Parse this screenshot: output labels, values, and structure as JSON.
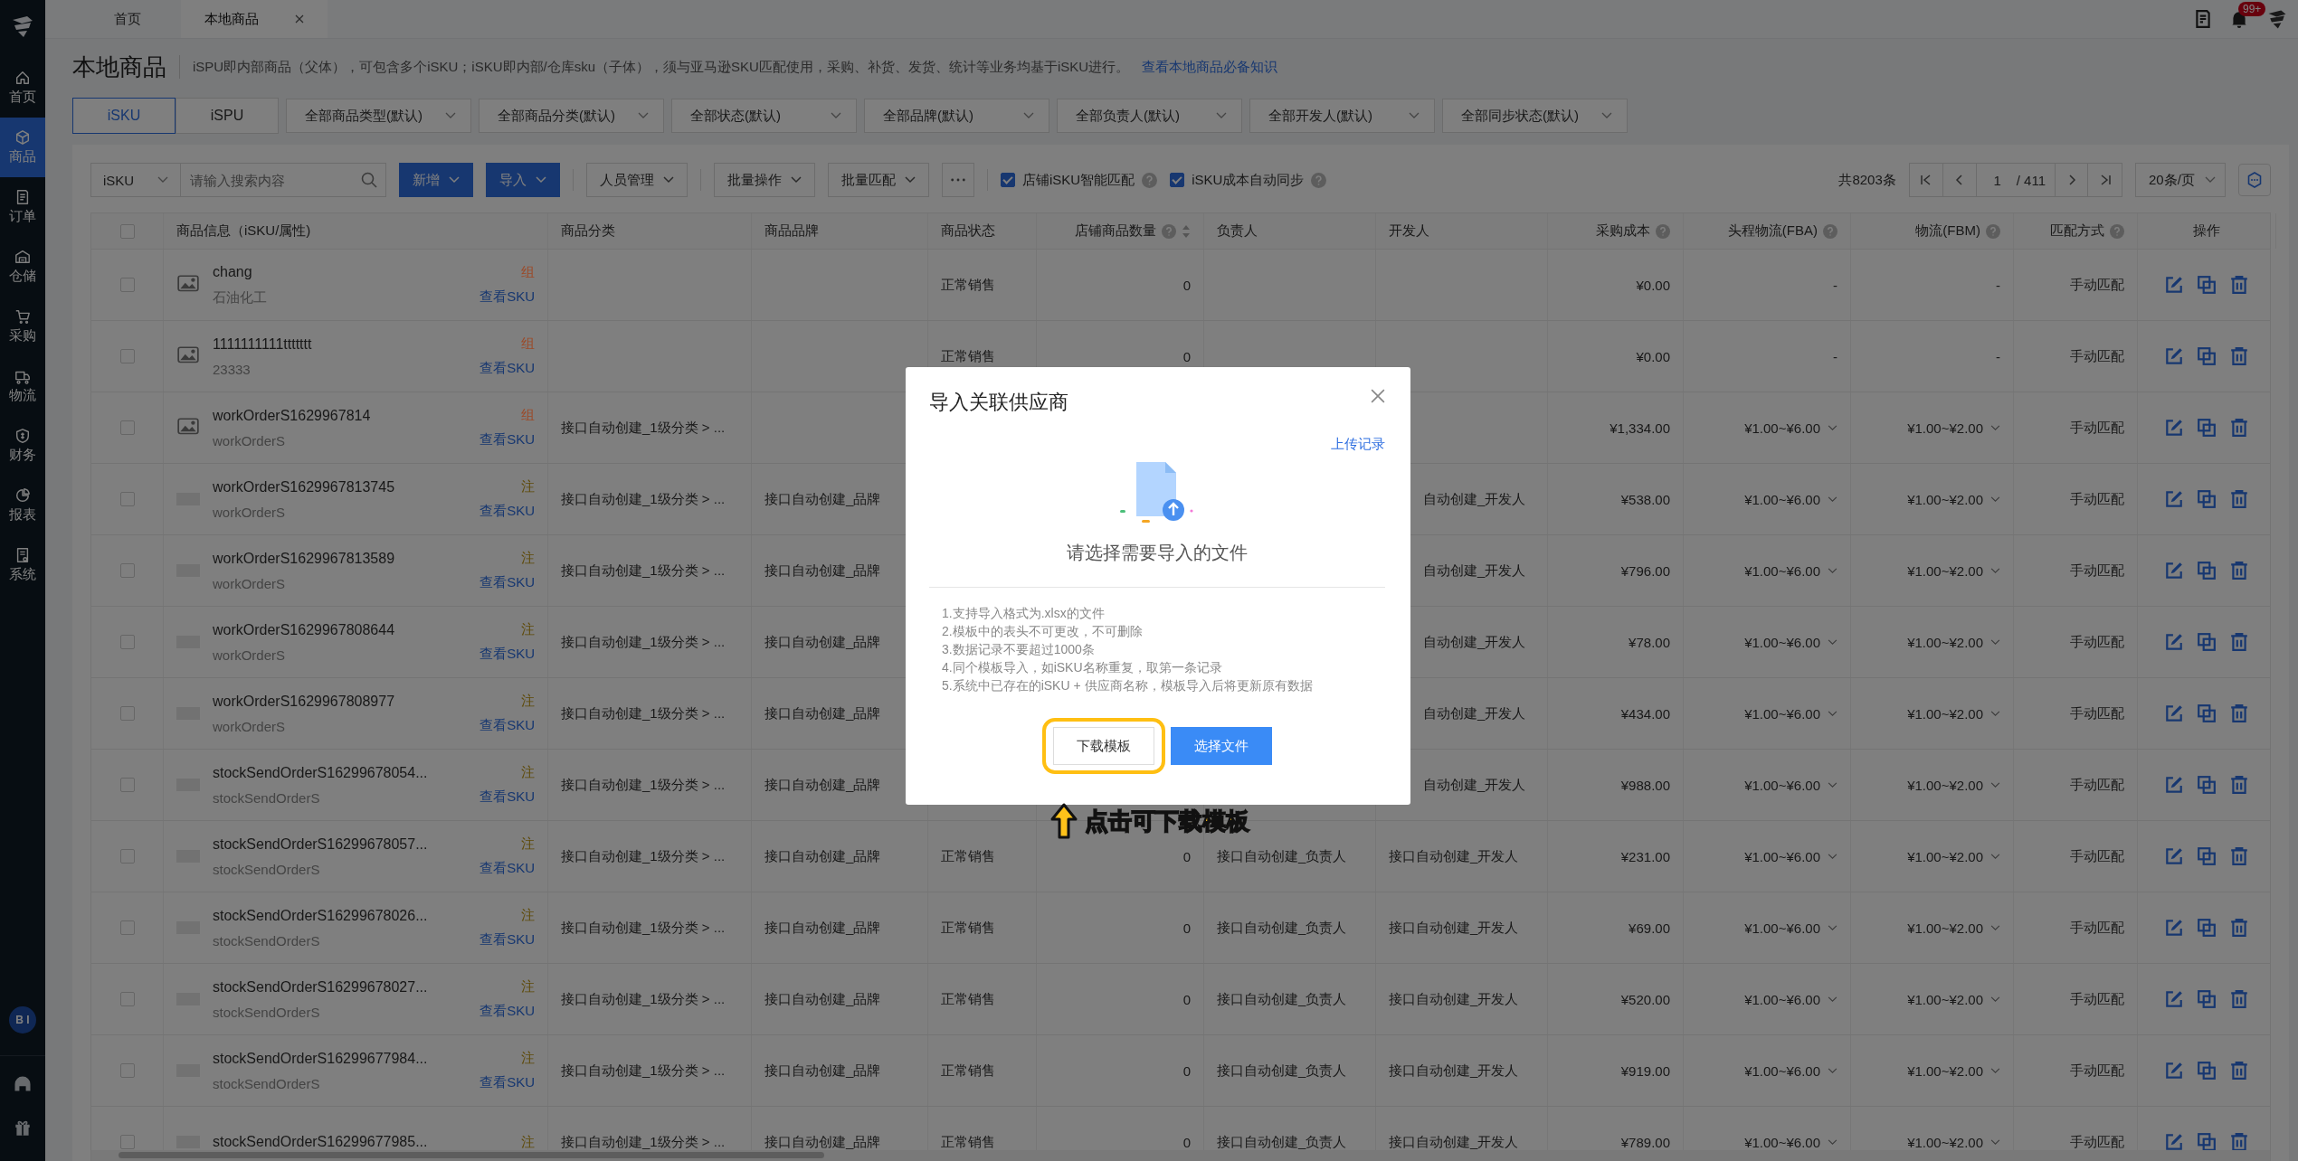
{
  "tabs": [
    {
      "label": "首页",
      "selected": false,
      "closable": false
    },
    {
      "label": "本地商品",
      "selected": true,
      "closable": true
    }
  ],
  "header": {
    "badge": "99+"
  },
  "sidebar": {
    "items": [
      {
        "label": "首页",
        "selected": false
      },
      {
        "label": "商品",
        "selected": true
      },
      {
        "label": "订单",
        "selected": false
      },
      {
        "label": "仓储",
        "selected": false
      },
      {
        "label": "采购",
        "selected": false
      },
      {
        "label": "物流",
        "selected": false
      },
      {
        "label": "财务",
        "selected": false
      },
      {
        "label": "报表",
        "selected": false
      },
      {
        "label": "系统",
        "selected": false
      }
    ],
    "bi": "B I"
  },
  "page": {
    "title": "本地商品",
    "description": "iSPU即内部商品（父体），可包含多个iSKU；iSKU即内部/仓库sku（子体），须与亚马逊SKU匹配使用，采购、补货、发货、统计等业务均基于iSKU进行。",
    "help_link": "查看本地商品必备知识"
  },
  "view_tabs": [
    {
      "label": "iSKU",
      "selected": true
    },
    {
      "label": "iSPU",
      "selected": false
    }
  ],
  "filters": [
    "全部商品类型(默认)",
    "全部商品分类(默认)",
    "全部状态(默认)",
    "全部品牌(默认)",
    "全部负责人(默认)",
    "全部开发人(默认)",
    "全部同步状态(默认)"
  ],
  "toolbar": {
    "search_type": "iSKU",
    "search_placeholder": "请输入搜索内容",
    "buttons": [
      {
        "label": "新增",
        "kind": "primary"
      },
      {
        "label": "导入",
        "kind": "primary"
      },
      {
        "label": "人员管理",
        "kind": "dropdown"
      },
      {
        "label": "批量操作",
        "kind": "dropdown"
      },
      {
        "label": "批量匹配",
        "kind": "dropdown"
      },
      {
        "kind": "more"
      }
    ],
    "checks": [
      {
        "label": "店铺iSKU智能匹配",
        "checked": true
      },
      {
        "label": "iSKU成本自动同步",
        "checked": true
      }
    ],
    "total": "共8203条",
    "page": "1",
    "pages": "/ 411",
    "page_size": "20条/页"
  },
  "table": {
    "all_checked": false,
    "columns": [
      {
        "label": "商品信息（iSKU/属性)"
      },
      {
        "label": "商品分类"
      },
      {
        "label": "商品品牌"
      },
      {
        "label": "商品状态"
      },
      {
        "label": "店铺商品数量",
        "help": true,
        "sort": true
      },
      {
        "label": "负责人"
      },
      {
        "label": "开发人"
      },
      {
        "label": "采购成本",
        "help": true
      },
      {
        "label": "头程物流(FBA)",
        "help": true
      },
      {
        "label": "物流(FBM)",
        "help": true
      },
      {
        "label": "匹配方式",
        "help": true
      },
      {
        "label": "操作"
      }
    ],
    "rows": [
      {
        "checked": false,
        "name": "chang",
        "sub": "石油化工",
        "tag": "组",
        "color": "#9c4a28",
        "link": "查看SKU",
        "photo": true,
        "status": "正常销售",
        "count": "0",
        "cost": "¥0.00",
        "fba": "-",
        "fbm": "-",
        "fba_menu": false,
        "fbm_menu": false,
        "match": "手动匹配"
      },
      {
        "checked": false,
        "name": "1111111111ttttttt",
        "sub": "23333",
        "tag": "组",
        "color": "#9c4a28",
        "link": "查看SKU",
        "photo": true,
        "status": "正常销售",
        "count": "0",
        "cost": "¥0.00",
        "fba": "-",
        "fbm": "-",
        "fba_menu": false,
        "fbm_menu": false,
        "match": "手动匹配"
      },
      {
        "checked": false,
        "name": "workOrderS1629967814",
        "sub": "workOrderS",
        "tag": "组",
        "color": "#9c4a28",
        "link": "查看SKU",
        "photo": true,
        "category": "接口自动创建_1级分类 > ...",
        "cost": "¥1,334.00",
        "fba": "¥1.00~¥6.00",
        "fbm": "¥1.00~¥2.00",
        "fba_menu": true,
        "fbm_menu": true,
        "match": "手动匹配"
      },
      {
        "checked": false,
        "name": "workOrderS1629967813745",
        "sub": "workOrderS",
        "tag": "注",
        "color": "#5e4a08",
        "link": "查看SKU",
        "photo": false,
        "category": "接口自动创建_1级分类 > ...",
        "brand": "接口自动创建_品牌",
        "covered": true,
        "developer": "自动创建_开发人",
        "cost": "¥538.00",
        "fba": "¥1.00~¥6.00",
        "fbm": "¥1.00~¥2.00",
        "fba_menu": true,
        "fbm_menu": true,
        "match": "手动匹配"
      },
      {
        "checked": false,
        "name": "workOrderS1629967813589",
        "sub": "workOrderS",
        "tag": "注",
        "color": "#5e4a08",
        "link": "查看SKU",
        "photo": false,
        "category": "接口自动创建_1级分类 > ...",
        "brand": "接口自动创建_品牌",
        "covered": true,
        "developer": "自动创建_开发人",
        "cost": "¥796.00",
        "fba": "¥1.00~¥6.00",
        "fbm": "¥1.00~¥2.00",
        "fba_menu": true,
        "fbm_menu": true,
        "match": "手动匹配"
      },
      {
        "checked": false,
        "name": "workOrderS1629967808644",
        "sub": "workOrderS",
        "tag": "注",
        "color": "#5e4a08",
        "link": "查看SKU",
        "photo": false,
        "category": "接口自动创建_1级分类 > ...",
        "brand": "接口自动创建_品牌",
        "covered": true,
        "developer": "自动创建_开发人",
        "cost": "¥78.00",
        "fba": "¥1.00~¥6.00",
        "fbm": "¥1.00~¥2.00",
        "fba_menu": true,
        "fbm_menu": true,
        "match": "手动匹配"
      },
      {
        "checked": false,
        "name": "workOrderS1629967808977",
        "sub": "workOrderS",
        "tag": "注",
        "color": "#5e4a08",
        "link": "查看SKU",
        "photo": false,
        "category": "接口自动创建_1级分类 > ...",
        "brand": "接口自动创建_品牌",
        "covered": true,
        "developer": "自动创建_开发人",
        "cost": "¥434.00",
        "fba": "¥1.00~¥6.00",
        "fbm": "¥1.00~¥2.00",
        "fba_menu": true,
        "fbm_menu": true,
        "match": "手动匹配"
      },
      {
        "checked": false,
        "name": "stockSendOrderS16299678054...",
        "sub": "stockSendOrderS",
        "tag": "注",
        "color": "#5e4a08",
        "link": "查看SKU",
        "photo": false,
        "category": "接口自动创建_1级分类 > ...",
        "brand": "接口自动创建_品牌",
        "covered": true,
        "developer": "自动创建_开发人",
        "cost": "¥988.00",
        "fba": "¥1.00~¥6.00",
        "fbm": "¥1.00~¥2.00",
        "fba_menu": true,
        "fbm_menu": true,
        "match": "手动匹配"
      },
      {
        "checked": false,
        "name": "stockSendOrderS16299678057...",
        "sub": "stockSendOrderS",
        "tag": "注",
        "color": "#5e4a08",
        "link": "查看SKU",
        "photo": false,
        "category": "接口自动创建_1级分类 > ...",
        "brand": "接口自动创建_品牌",
        "status": "正常销售",
        "count": "0",
        "owner": "接口自动创建_负责人",
        "developer": "接口自动创建_开发人",
        "cost": "¥231.00",
        "fba": "¥1.00~¥6.00",
        "fbm": "¥1.00~¥2.00",
        "fba_menu": true,
        "fbm_menu": true,
        "match": "手动匹配"
      },
      {
        "checked": false,
        "name": "stockSendOrderS16299678026...",
        "sub": "stockSendOrderS",
        "tag": "注",
        "color": "#5e4a08",
        "link": "查看SKU",
        "photo": false,
        "category": "接口自动创建_1级分类 > ...",
        "brand": "接口自动创建_品牌",
        "status": "正常销售",
        "count": "0",
        "owner": "接口自动创建_负责人",
        "developer": "接口自动创建_开发人",
        "cost": "¥69.00",
        "fba": "¥1.00~¥6.00",
        "fbm": "¥1.00~¥2.00",
        "fba_menu": true,
        "fbm_menu": true,
        "match": "手动匹配"
      },
      {
        "checked": false,
        "name": "stockSendOrderS16299678027...",
        "sub": "stockSendOrderS",
        "tag": "注",
        "color": "#5e4a08",
        "link": "查看SKU",
        "photo": false,
        "category": "接口自动创建_1级分类 > ...",
        "brand": "接口自动创建_品牌",
        "status": "正常销售",
        "count": "0",
        "owner": "接口自动创建_负责人",
        "developer": "接口自动创建_开发人",
        "cost": "¥520.00",
        "fba": "¥1.00~¥6.00",
        "fbm": "¥1.00~¥2.00",
        "fba_menu": true,
        "fbm_menu": true,
        "match": "手动匹配"
      },
      {
        "checked": false,
        "name": "stockSendOrderS16299677984...",
        "sub": "stockSendOrderS",
        "tag": "注",
        "color": "#5e4a08",
        "link": "查看SKU",
        "photo": false,
        "category": "接口自动创建_1级分类 > ...",
        "brand": "接口自动创建_品牌",
        "status": "正常销售",
        "count": "0",
        "owner": "接口自动创建_负责人",
        "developer": "接口自动创建_开发人",
        "cost": "¥919.00",
        "fba": "¥1.00~¥6.00",
        "fbm": "¥1.00~¥2.00",
        "fba_menu": true,
        "fbm_menu": true,
        "match": "手动匹配"
      },
      {
        "checked": false,
        "name": "stockSendOrderS16299677985...",
        "tag": "注",
        "color": "#5e4a08",
        "photo": false,
        "category": "接口自动创建_1级分类 > ...",
        "brand": "接口自动创建_品牌",
        "status": "正常销售",
        "count": "0",
        "owner": "接口自动创建_负责人",
        "developer": "接口自动创建_开发人",
        "cost": "¥789.00",
        "fba": "¥1.00~¥6.00",
        "fbm": "¥1.00~¥2.00",
        "fba_menu": true,
        "fbm_menu": true,
        "match": "手动匹配"
      }
    ]
  },
  "modal": {
    "title": "导入关联供应商",
    "record_link": "上传记录",
    "prompt": "请选择需要导入的文件",
    "notes": [
      "1.支持导入格式为.xlsx的文件",
      "2.模板中的表头不可更改，不可删除",
      "3.数据记录不要超过1000条",
      "4.同个模板导入，如iSKU名称重复，取第一条记录",
      "5.系统中已存在的iSKU + 供应商名称，模板导入后将更新原有数据"
    ],
    "buttons": [
      {
        "label": "下载模板",
        "kind": "default",
        "highlighted": true
      },
      {
        "label": "选择文件",
        "kind": "primary",
        "highlighted": false
      }
    ]
  },
  "annotation": "点击可下载模板"
}
